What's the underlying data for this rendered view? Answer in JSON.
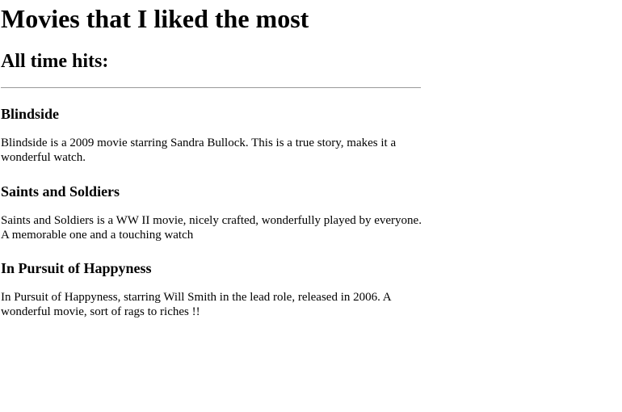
{
  "page": {
    "title": "Movies that I liked the most",
    "section_title": "All time hits:"
  },
  "movies": [
    {
      "title": "Blindside",
      "description": "Blindside is a 2009 movie starring Sandra Bullock. This is a true story, makes it a wonderful watch."
    },
    {
      "title": "Saints and Soldiers",
      "description": "Saints and Soldiers is a WW II movie, nicely crafted, wonderfully played by everyone. A memorable one and a touching watch"
    },
    {
      "title": "In Pursuit of Happyness",
      "description": "In Pursuit of Happyness, starring Will Smith in the lead role, released in 2006. A wonderful movie, sort of rags to riches !!"
    }
  ]
}
